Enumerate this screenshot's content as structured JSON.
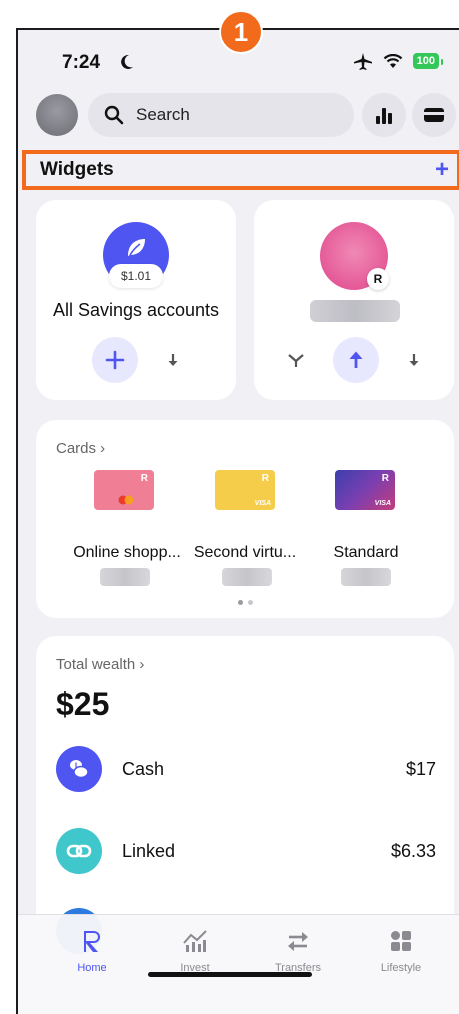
{
  "annotation": {
    "step": "1"
  },
  "status": {
    "time": "7:24",
    "battery": "100"
  },
  "topbar": {
    "search_placeholder": "Search"
  },
  "widgets": {
    "title": "Widgets",
    "add_label": "+"
  },
  "savings_widget": {
    "amount": "$1.01",
    "label": "All Savings accounts"
  },
  "cards_widget": {
    "title": "Cards ›",
    "cards": [
      {
        "name": "Online shopp...",
        "color": "#f07f95"
      },
      {
        "name": "Second virtu...",
        "color": "#f5cd4a"
      },
      {
        "name": "Standard",
        "color": "#5a3fb7"
      }
    ]
  },
  "wealth": {
    "title": "Total wealth ›",
    "total": "$25",
    "rows": [
      {
        "label": "Cash",
        "value": "$17",
        "icon": "coins-icon",
        "color": "#4f55f1"
      },
      {
        "label": "Linked",
        "value": "$6.33",
        "icon": "link-icon",
        "color": "#3fc7cc"
      }
    ]
  },
  "tabs": [
    {
      "label": "Home",
      "icon": "revolut-r-icon",
      "active": true
    },
    {
      "label": "Invest",
      "icon": "chart-icon",
      "active": false
    },
    {
      "label": "Transfers",
      "icon": "transfer-icon",
      "active": false
    },
    {
      "label": "Lifestyle",
      "icon": "grid-icon",
      "active": false
    }
  ],
  "colors": {
    "accent": "#4f55f1",
    "annotation": "#f26a1b"
  }
}
